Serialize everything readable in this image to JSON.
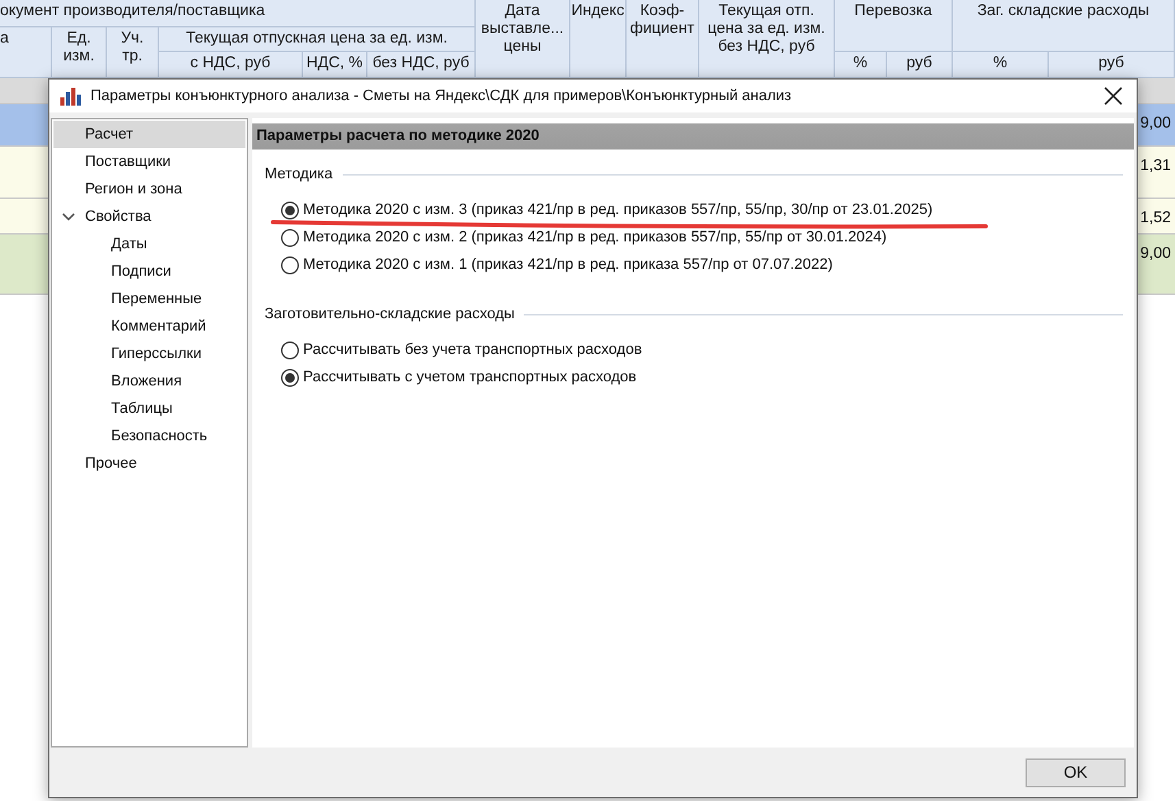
{
  "grid": {
    "header": [
      {
        "text": "окумент производителя/поставщика"
      },
      {
        "text": "Дата выставле... цены"
      },
      {
        "text": "Индекс"
      },
      {
        "text": "Коэф-фициент"
      },
      {
        "text": "Текущая отп. цена за ед. изм. без НДС, руб"
      },
      {
        "text": "Перевозка"
      },
      {
        "text": "Заг. складские расходы"
      },
      {
        "text": "а"
      },
      {
        "text": "Ед. изм."
      },
      {
        "text": "Уч. тр."
      },
      {
        "text": "Текущая отпускная цена за ед. изм."
      },
      {
        "text": "с НДС, руб"
      },
      {
        "text": "НДС, %"
      },
      {
        "text": "без НДС, руб"
      },
      {
        "text": "%"
      },
      {
        "text": "руб"
      },
      {
        "text": "%"
      },
      {
        "text": "руб"
      }
    ],
    "rows": [
      {
        "color": "#dadada"
      },
      {
        "color": "#a4c0ea",
        "value": "9,00"
      },
      {
        "color": "#fbfbe9",
        "value": "1,31"
      },
      {
        "color": "#fbfbe9",
        "value": "1,52"
      },
      {
        "color": "#dde9c9",
        "value": "9,00"
      }
    ]
  },
  "dialog": {
    "title": "Параметры конъюнктурного анализа - Сметы на Яндекс\\СДК для примеров\\Конъюнктурный анализ",
    "tree": [
      {
        "label": "Расчет",
        "selected": true
      },
      {
        "label": "Поставщики",
        "selected": false
      },
      {
        "label": "Регион и зона",
        "selected": false
      },
      {
        "label": "Свойства",
        "selected": false,
        "expanded": true,
        "children": [
          {
            "label": "Даты",
            "selected": false
          },
          {
            "label": "Подписи",
            "selected": false
          },
          {
            "label": "Переменные",
            "selected": false
          },
          {
            "label": "Комментарий",
            "selected": false
          },
          {
            "label": "Гиперссылки",
            "selected": false
          },
          {
            "label": "Вложения",
            "selected": false
          },
          {
            "label": "Таблицы",
            "selected": false
          },
          {
            "label": "Безопасность",
            "selected": false
          }
        ]
      },
      {
        "label": "Прочее",
        "selected": false
      }
    ],
    "panel_title": "Параметры расчета по методике 2020",
    "groups": [
      {
        "title": "Методика",
        "options": [
          {
            "label": "Методика 2020 с изм. 3 (приказ 421/пр в ред. приказов 557/пр, 55/пр, 30/пр от 23.01.2025)",
            "selected": true
          },
          {
            "label": "Методика 2020 с изм. 2 (приказ 421/пр в ред. приказов 557/пр, 55/пр от 30.01.2024)",
            "selected": false
          },
          {
            "label": "Методика 2020 с изм. 1 (приказ 421/пр в ред. приказа 557/пр от 07.07.2022)",
            "selected": false
          }
        ]
      },
      {
        "title": "Заготовительно-складские расходы",
        "options": [
          {
            "label": "Рассчитывать без учета транспортных расходов",
            "selected": false
          },
          {
            "label": "Рассчитывать с учетом транспортных расходов",
            "selected": true
          }
        ]
      }
    ],
    "ok_button": "OK"
  }
}
